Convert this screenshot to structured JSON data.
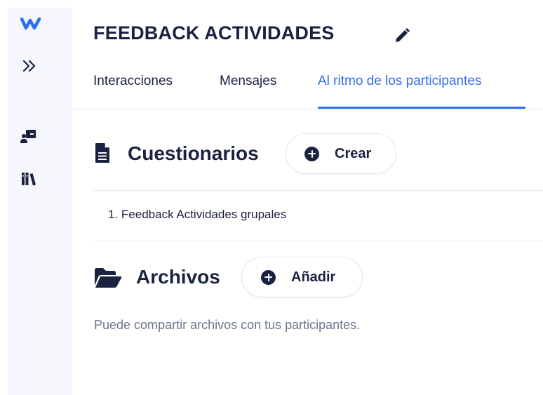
{
  "sidebar": {
    "logo_icon": "w-logo-icon",
    "expand_icon": "double-chevron-right-icon",
    "items": [
      {
        "icon": "presentation-board-icon"
      },
      {
        "icon": "library-books-icon"
      }
    ]
  },
  "header": {
    "title": "FEEDBACK ACTIVIDADES",
    "edit_icon": "pencil-icon"
  },
  "tabs": [
    {
      "label": "Interacciones",
      "active": false
    },
    {
      "label": "Mensajes",
      "active": false
    },
    {
      "label": "Al ritmo de los participantes",
      "active": true
    }
  ],
  "quizzes": {
    "icon": "document-icon",
    "title": "Cuestionarios",
    "button_label": "Crear",
    "items": [
      {
        "number": "1.",
        "label": "Feedback Actividades grupales"
      }
    ]
  },
  "files": {
    "icon": "folder-open-icon",
    "title": "Archivos",
    "button_label": "Añadir",
    "helper_text": "Puede compartir archivos con tus participantes."
  },
  "colors": {
    "accent": "#2f6fed",
    "text": "#1b2240",
    "muted": "#6c7590",
    "sidebar_bg": "#f5f7fd",
    "divider": "#e6e9f1"
  }
}
